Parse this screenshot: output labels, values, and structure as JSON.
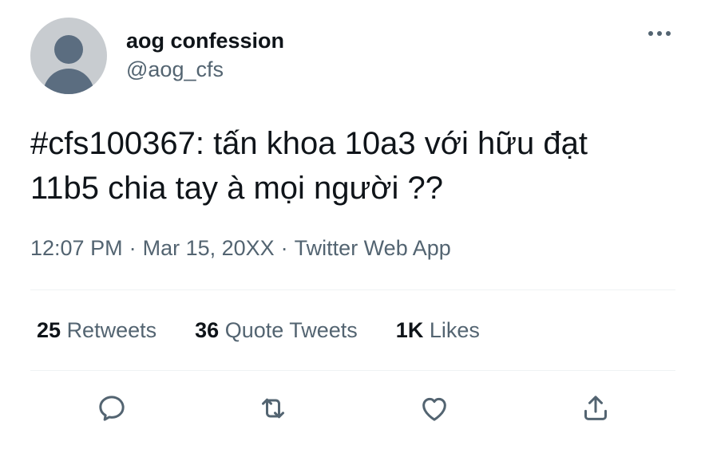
{
  "author": {
    "display_name": "aog confession",
    "handle": "@aog_cfs"
  },
  "tweet": {
    "text_line1": "#cfs100367: tấn khoa 10a3 với hữu đạt",
    "text_line2": "11b5 chia tay à mọi người ??",
    "time": "12:07 PM",
    "date": "Mar 15, 20XX",
    "source": "Twitter Web App",
    "separator": "·"
  },
  "stats": {
    "retweets_count": "25",
    "retweets_label": "Retweets",
    "quotes_count": "36",
    "quotes_label": "Quote Tweets",
    "likes_count": "1K",
    "likes_label": "Likes"
  },
  "actions": [
    "reply-icon",
    "retweet-icon",
    "like-icon",
    "share-icon"
  ],
  "colors": {
    "text_primary": "#0f1419",
    "text_secondary": "#536471",
    "divider": "#eff3f4",
    "avatar_bg": "#c8ccd0",
    "avatar_fg": "#5b6d80"
  }
}
